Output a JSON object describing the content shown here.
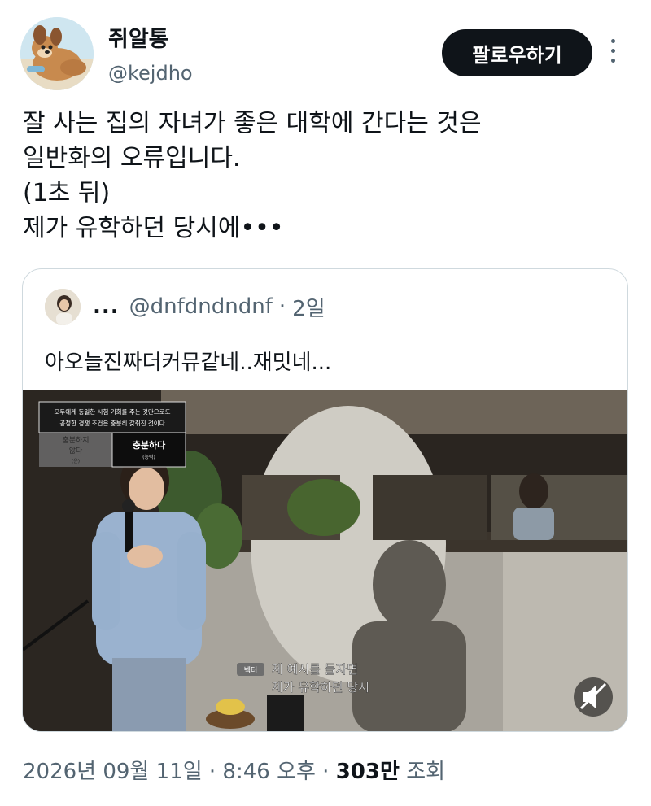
{
  "author": {
    "name": "쥐알통",
    "handle": "@kejdho",
    "avatar_icon": "dog-avatar"
  },
  "follow_label": "팔로우하기",
  "more_icon": "more-vertical-icon",
  "tweet_lines": [
    "잘 사는 집의 자녀가 좋은 대학에 간다는 것은",
    "일반화의 오류입니다.",
    "(1초 뒤)",
    "제가 유학하던 당시에•••"
  ],
  "quoted": {
    "name": "...",
    "handle": "@dnfdndndnf",
    "separator": "·",
    "time": "2일",
    "text": "아오늘진짜더커뮤같네..재밋네...",
    "video": {
      "overlay_heading_line1": "모두에게 동일한 시험 기회를 주는 것만으로도",
      "overlay_heading_line2": "공정한 경쟁 조건은 충분히 갖춰진 것이다",
      "option_left_line1": "충분하지",
      "option_left_line2": "않다",
      "option_left_sub": "(운)",
      "option_right": "충분하다",
      "option_right_sub": "(능력)",
      "speaker_tag": "벡터",
      "subtitle_line1": "제 예시를 들자면",
      "subtitle_line2": "제가 유학하던 당시",
      "mute_icon": "muted-speaker-icon"
    }
  },
  "footer": {
    "timestamp": "2026년 09월 11일 · 8:46 오후 ·",
    "views": "303만",
    "views_suffix": "조회"
  }
}
